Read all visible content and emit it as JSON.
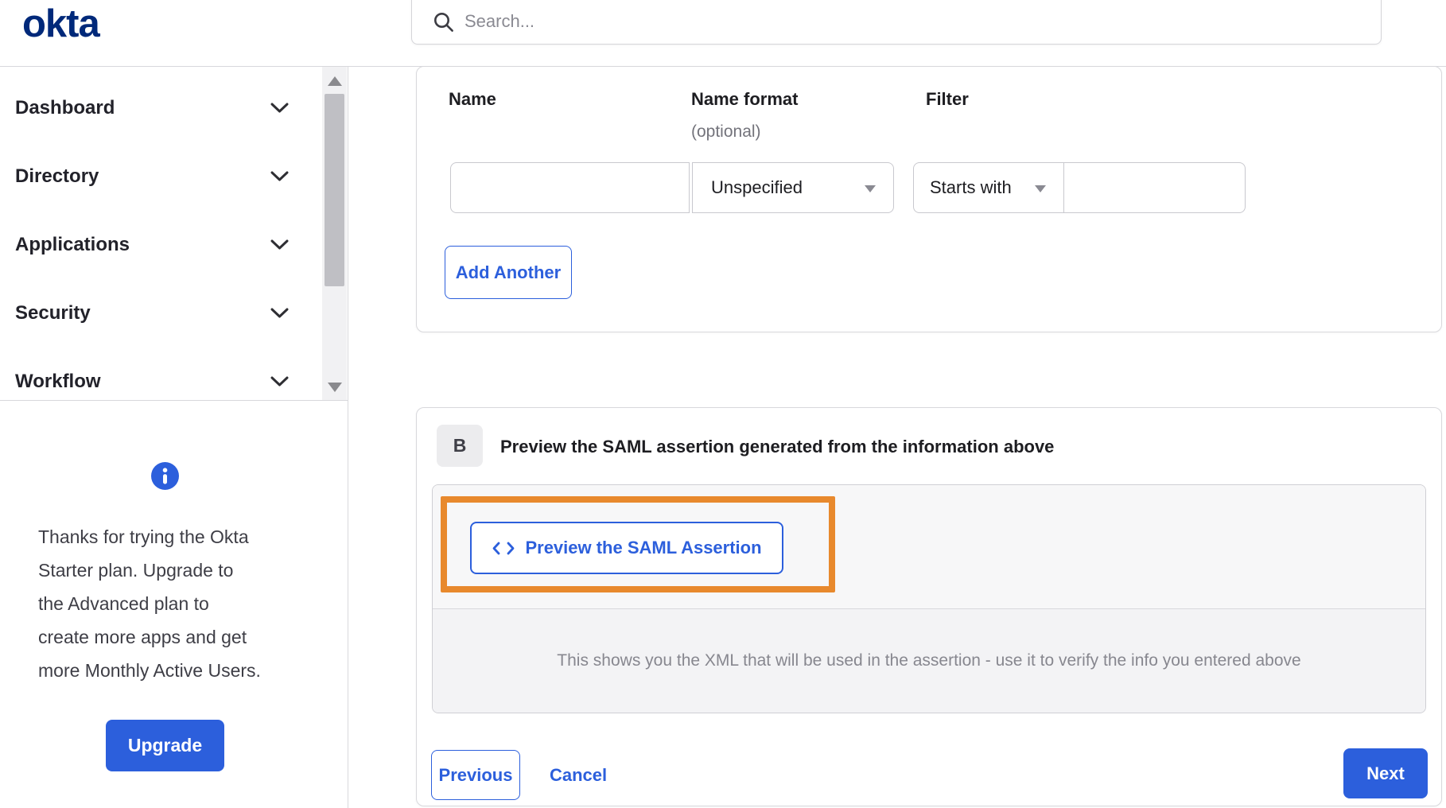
{
  "header": {
    "logo_text": "okta",
    "search_placeholder": "Search..."
  },
  "sidebar": {
    "items": [
      {
        "label": "Dashboard"
      },
      {
        "label": "Directory"
      },
      {
        "label": "Applications"
      },
      {
        "label": "Security"
      },
      {
        "label": "Workflow"
      }
    ]
  },
  "upgrade": {
    "message": "Thanks for trying the Okta Starter plan. Upgrade to the Advanced plan to create more apps and get more Monthly Active Users.",
    "message_lines": [
      "Thanks for trying the Okta",
      "Starter plan. Upgrade to",
      "the Advanced plan to",
      "create more apps and get",
      "more Monthly Active Users."
    ],
    "button_label": "Upgrade"
  },
  "attribute_form": {
    "name_label": "Name",
    "name_format_label": "Name format",
    "name_format_sublabel": "(optional)",
    "filter_label": "Filter",
    "name_value": "",
    "name_format_value": "Unspecified",
    "filter_operator_value": "Starts with",
    "filter_value": "",
    "add_another_label": "Add Another"
  },
  "preview_section": {
    "badge": "B",
    "heading": "Preview the SAML assertion generated from the information above",
    "button_label": "Preview the SAML Assertion",
    "caption": "This shows you the XML that will be used in the assertion - use it to verify the info you entered above"
  },
  "footer": {
    "previous_label": "Previous",
    "cancel_label": "Cancel",
    "next_label": "Next"
  },
  "colors": {
    "accent_blue": "#2C5FDC",
    "brand_navy": "#00297A",
    "highlight_orange": "#E8892D"
  }
}
